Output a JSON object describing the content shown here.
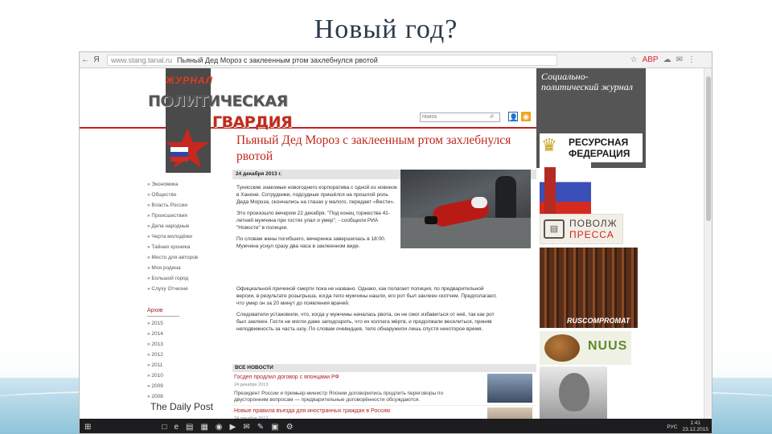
{
  "slide": {
    "title": "Новый год?"
  },
  "browser": {
    "back": "←",
    "menu": "Я",
    "domain": "www.stang.tanal.ru",
    "page_title": "Пьяный Дед Мороз с заклеенным ртом захлебнулся рвотой",
    "tools": [
      "☆",
      "ABP",
      "☁",
      "✉",
      "⋮"
    ]
  },
  "site": {
    "logo_top": "ЖУРНАЛ",
    "logo_line1": "ПОЛИТИЧЕСКАЯ",
    "logo_line2": "ГВАРДИЯ",
    "search_placeholder": "поиск",
    "menu": [
      "» Экономика",
      "» Общество",
      "» Власть России",
      "» Происшествия",
      "» Дела народные",
      "» Черта молодёжи",
      "» Тайная хроника",
      "» Место для авторов",
      "» Моя родина",
      "» Большой город",
      "» Слуху Отчизне"
    ],
    "archive_title": "Архив",
    "archive": [
      "» 2015",
      "» 2014",
      "» 2013",
      "» 2012",
      "» 2011",
      "» 2010",
      "» 2009",
      "» 2008"
    ],
    "daily_post": "The Daily Post"
  },
  "article": {
    "title": "Пьяный Дед Мороз с заклеенным ртом захлебнулся рвотой",
    "date": "24 декабря 2013 г.",
    "p1": "Тунисские знакомые новогоднего корпоратива с одной из новинок в Ханоне. Сотрудники, подсудные пришёлся на прошлой роль Деда Мороза, скончались на глазах у малого, передает «Вести».",
    "p2": "Это произошло вечером 22 декабря. \"Под конец торжества 41-летний мужчина при гостях упал и умер\", - сообщили РИА \"Новости\" в полиции.",
    "p3": "По словам жены погибшего, вечеринка завершилась в 18:00. Мужчина уснул сразу два часа в заклеенном виде.",
    "p4": "Официальной причиной смерти пока не названо. Однако, как полагает полиция, по предварительной версии, в результате розыгрыша, когда тело мужчины нашли, его рот был заклеен скотчем. Предполагают, что умер он за 20 минут до появления врачей.",
    "p5": "Следователи установили, что, когда у мужчины началась рвота, он не смог избавиться от неё, так как рот был заклеен. Гости не могли даже заподозрить, что их коллега мёртв, и продолжали веселиться, приняв неподвижность за часть шоу. По словам очевидцев, тело обнаружили лишь спустя некоторое время."
  },
  "news": {
    "header": "ВСЕ НОВОСТИ",
    "items": [
      {
        "title": "Госдеп продлил договор с японцами РФ",
        "date": "24 декабря 2013",
        "text": "Президент России и премьер-министр Японии договорились продлить переговоры по двусторонним вопросам — предварительные договорённости обсуждаются."
      },
      {
        "title": "Новые правила въезда для иностранных граждан в Россию",
        "date": "24 декабря 2013",
        "text": ""
      }
    ]
  },
  "right_panel": {
    "header": "Социально-политический журнал",
    "resurs_1": "РЕСУРСНАЯ",
    "resurs_2": "ФЕДЕРАЦИЯ",
    "povlya_1": "ПОВОЛЖ",
    "povlya_2": "ПРЕССА",
    "books": "RUSCOMPROMAT",
    "nuus": "NUUS"
  },
  "taskbar": {
    "start": "⊞",
    "apps": [
      "□",
      "e",
      "▤",
      "▦",
      "◉",
      "▶",
      "✉",
      "✎",
      "▣",
      "⚙"
    ],
    "lang": "РУС",
    "time": "1:41",
    "date": "23.12.2015"
  },
  "colors": {
    "accent": "#c0271d",
    "panel": "#555555"
  }
}
